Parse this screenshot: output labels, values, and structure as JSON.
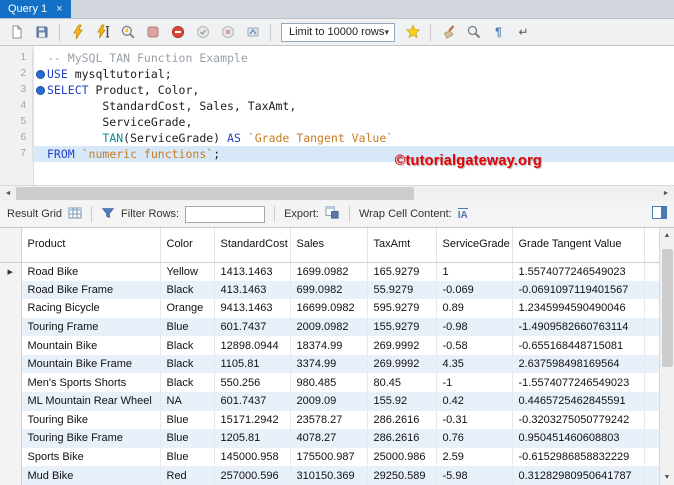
{
  "tab": {
    "title": "Query 1"
  },
  "toolbar": {
    "limit_label": "Limit to 10000 rows"
  },
  "editor": {
    "lines": [
      {
        "num": "1",
        "dot": false,
        "highlight": false,
        "segments": [
          {
            "t": "-- MySQL TAN Function Example",
            "c": "comment"
          }
        ]
      },
      {
        "num": "2",
        "dot": true,
        "highlight": false,
        "segments": [
          {
            "t": "USE ",
            "c": "keyword"
          },
          {
            "t": "mysqltutorial;",
            "c": "plain"
          }
        ]
      },
      {
        "num": "3",
        "dot": true,
        "highlight": false,
        "segments": [
          {
            "t": "SELECT ",
            "c": "keyword"
          },
          {
            "t": "Product, Color,",
            "c": "plain"
          }
        ]
      },
      {
        "num": "4",
        "dot": false,
        "highlight": false,
        "segments": [
          {
            "t": "        StandardCost, Sales, TaxAmt,",
            "c": "plain"
          }
        ]
      },
      {
        "num": "5",
        "dot": false,
        "highlight": false,
        "segments": [
          {
            "t": "        ServiceGrade,",
            "c": "plain"
          }
        ]
      },
      {
        "num": "6",
        "dot": false,
        "highlight": false,
        "segments": [
          {
            "t": "        ",
            "c": "plain"
          },
          {
            "t": "TAN",
            "c": "function"
          },
          {
            "t": "(ServiceGrade) ",
            "c": "plain"
          },
          {
            "t": "AS ",
            "c": "keyword"
          },
          {
            "t": "`Grade Tangent Value`",
            "c": "string"
          }
        ]
      },
      {
        "num": "7",
        "dot": false,
        "highlight": true,
        "segments": [
          {
            "t": "FROM ",
            "c": "keyword"
          },
          {
            "t": "`numeric functions`",
            "c": "string"
          },
          {
            "t": ";",
            "c": "plain"
          }
        ]
      }
    ]
  },
  "watermark": "©tutorialgateway.org",
  "result_toolbar": {
    "result_grid_label": "Result Grid",
    "filter_label": "Filter Rows:",
    "filter_value": "",
    "export_label": "Export:",
    "wrap_label": "Wrap Cell Content:"
  },
  "grid": {
    "columns": [
      "Product",
      "Color",
      "StandardCost",
      "Sales",
      "TaxAmt",
      "ServiceGrade",
      "Grade Tangent Value"
    ],
    "rows": [
      [
        "Road Bike",
        "Yellow",
        "1413.1463",
        "1699.0982",
        "165.9279",
        "1",
        "1.5574077246549023"
      ],
      [
        "Road Bike Frame",
        "Black",
        "413.1463",
        "699.0982",
        "55.9279",
        "-0.069",
        "-0.0691097119401567"
      ],
      [
        "Racing Bicycle",
        "Orange",
        "9413.1463",
        "16699.0982",
        "595.9279",
        "0.89",
        "1.2345994590490046"
      ],
      [
        "Touring Frame",
        "Blue",
        "601.7437",
        "2009.0982",
        "155.9279",
        "-0.98",
        "-1.4909582660763114"
      ],
      [
        "Mountain Bike",
        "Black",
        "12898.0944",
        "18374.99",
        "269.9992",
        "-0.58",
        "-0.655168448715081"
      ],
      [
        "Mountain Bike Frame",
        "Black",
        "1105.81",
        "3374.99",
        "269.9992",
        "4.35",
        "2.637598498169564"
      ],
      [
        "Men's Sports Shorts",
        "Black",
        "550.256",
        "980.485",
        "80.45",
        "-1",
        "-1.5574077246549023"
      ],
      [
        "ML Mountain Rear Wheel",
        "NA",
        "601.7437",
        "2009.09",
        "155.92",
        "0.42",
        "0.4465725462845591"
      ],
      [
        "Touring Bike",
        "Blue",
        "15171.2942",
        "23578.27",
        "286.2616",
        "-0.31",
        "-0.3203275050779242"
      ],
      [
        "Touring Bike Frame",
        "Blue",
        "1205.81",
        "4078.27",
        "286.2616",
        "0.76",
        "0.950451460608803"
      ],
      [
        "Sports Bike",
        "Blue",
        "145000.958",
        "175500.987",
        "25000.986",
        "2.59",
        "-0.6152986858832229"
      ],
      [
        "Mud Bike",
        "Red",
        "257000.596",
        "310150.369",
        "29250.589",
        "-5.98",
        "0.31282980950641787"
      ]
    ]
  },
  "colors": {
    "accent_blue": "#1370c5",
    "keyword": "#2440c8",
    "comment": "#9aa0a8",
    "function": "#0f8b8d",
    "string": "#c87a22",
    "watermark_red": "#e60000",
    "row_alt": "#e8f0fa"
  }
}
